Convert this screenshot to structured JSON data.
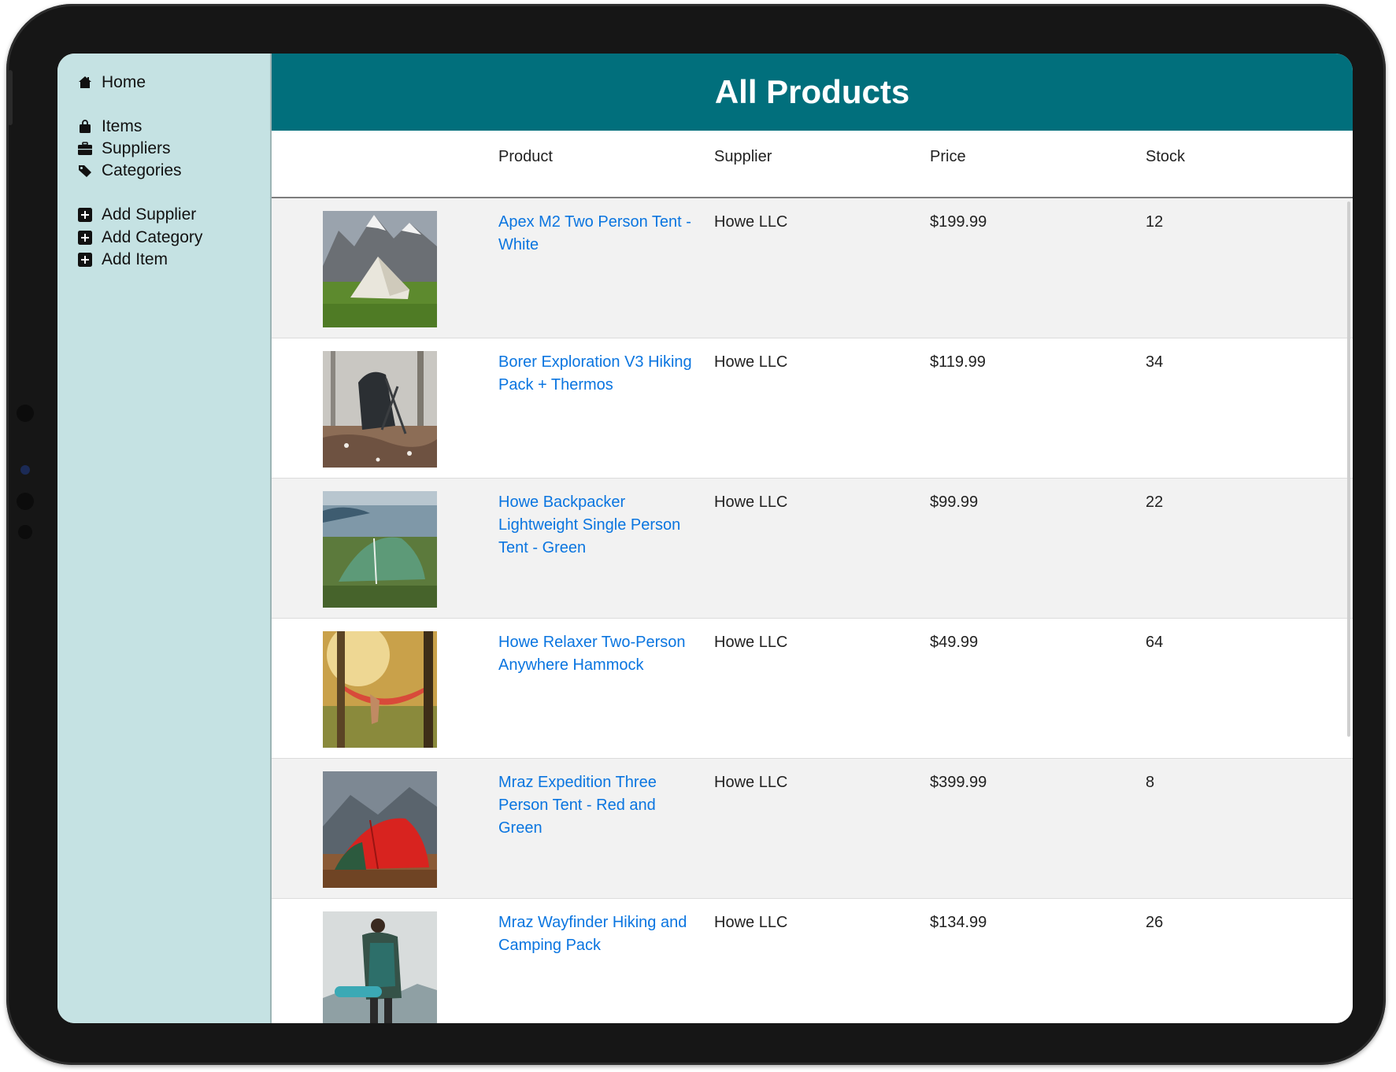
{
  "sidebar": {
    "home": {
      "label": "Home",
      "icon": "home-icon"
    },
    "items": {
      "label": "Items",
      "icon": "shopping-bag-icon"
    },
    "suppliers": {
      "label": "Suppliers",
      "icon": "briefcase-icon"
    },
    "categories": {
      "label": "Categories",
      "icon": "tag-icon"
    },
    "add_supplier": {
      "label": "Add Supplier",
      "icon": "plus-square-icon"
    },
    "add_category": {
      "label": "Add Category",
      "icon": "plus-square-icon"
    },
    "add_item": {
      "label": "Add Item",
      "icon": "plus-square-icon"
    }
  },
  "header": {
    "title": "All Products"
  },
  "table": {
    "columns": {
      "product": "Product",
      "supplier": "Supplier",
      "price": "Price",
      "stock": "Stock"
    },
    "rows": [
      {
        "product": "Apex M2 Two Person Tent - White",
        "supplier": "Howe LLC",
        "price": "$199.99",
        "stock": "12",
        "image": "white-tent-mountains"
      },
      {
        "product": "Borer Exploration V3 Hiking Pack + Thermos",
        "supplier": "Howe LLC",
        "price": "$119.99",
        "stock": "34",
        "image": "hiking-pack-forest"
      },
      {
        "product": "Howe Backpacker Lightweight Single Person Tent - Green",
        "supplier": "Howe LLC",
        "price": "$99.99",
        "stock": "22",
        "image": "green-tent-beach"
      },
      {
        "product": "Howe Relaxer Two-Person Anywhere Hammock",
        "supplier": "Howe LLC",
        "price": "$49.99",
        "stock": "64",
        "image": "hammock-sunlight"
      },
      {
        "product": "Mraz Expedition Three Person Tent - Red and Green",
        "supplier": "Howe LLC",
        "price": "$399.99",
        "stock": "8",
        "image": "red-tent-hills"
      },
      {
        "product": "Mraz Wayfinder Hiking and Camping Pack",
        "supplier": "Howe LLC",
        "price": "$134.99",
        "stock": "26",
        "image": "hiker-backpack"
      }
    ]
  },
  "colors": {
    "header_bg": "#016f7c",
    "sidebar_bg": "#c5e2e3",
    "link": "#0a75e0",
    "row_alt": "#f2f2f2"
  }
}
